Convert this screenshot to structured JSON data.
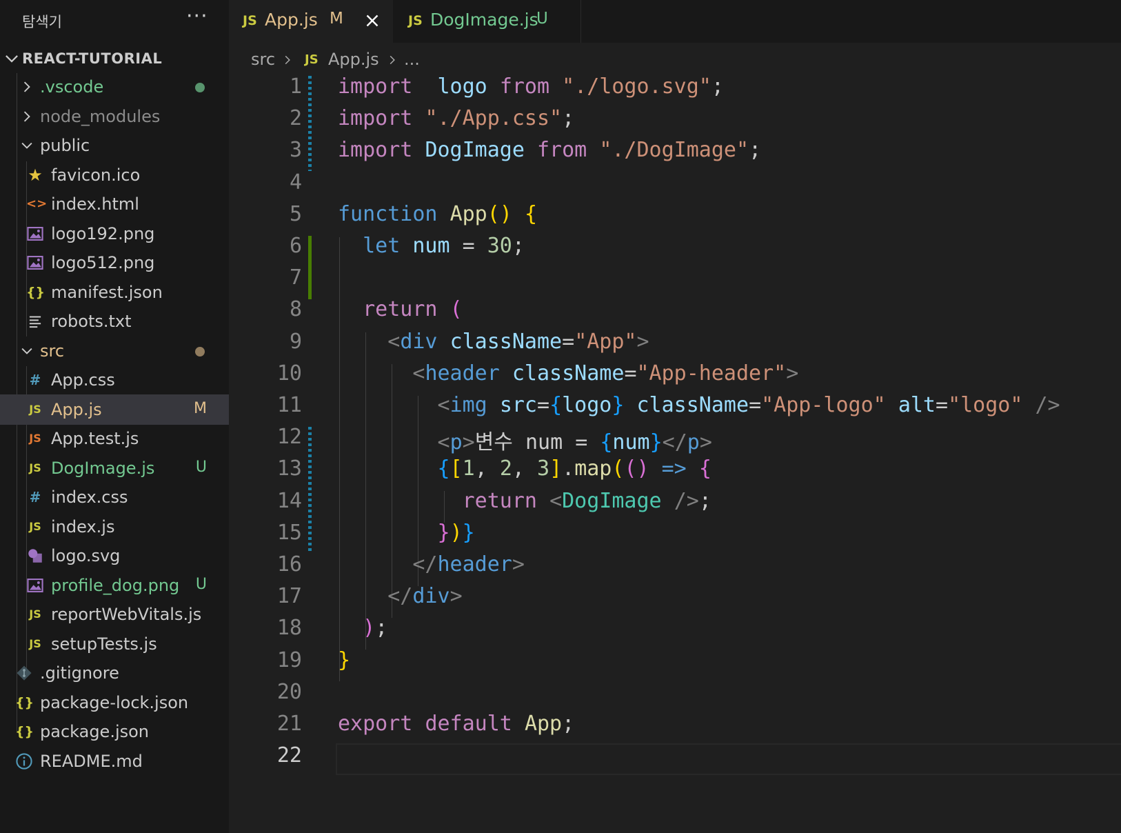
{
  "sidebar": {
    "title": "탐색기",
    "more": "···",
    "project": "REACT-TUTORIAL",
    "items": [
      {
        "label": ".vscode",
        "icon": "chevron-right-icon"
      },
      {
        "label": "node_modules",
        "icon": "chevron-right-icon"
      },
      {
        "label": "public",
        "icon": "chevron-down-icon"
      },
      {
        "label": "favicon.ico",
        "icon": "star-icon"
      },
      {
        "label": "index.html",
        "icon": "html-icon"
      },
      {
        "label": "logo192.png",
        "icon": "image-icon"
      },
      {
        "label": "logo512.png",
        "icon": "image-icon"
      },
      {
        "label": "manifest.json",
        "icon": "json-icon"
      },
      {
        "label": "robots.txt",
        "icon": "text-file-icon"
      },
      {
        "label": "src",
        "icon": "chevron-down-icon"
      },
      {
        "label": "App.css",
        "icon": "css-icon"
      },
      {
        "label": "App.js",
        "icon": "js-icon",
        "status": "M"
      },
      {
        "label": "App.test.js",
        "icon": "js-test-icon"
      },
      {
        "label": "DogImage.js",
        "icon": "js-icon",
        "status": "U"
      },
      {
        "label": "index.css",
        "icon": "css-icon"
      },
      {
        "label": "index.js",
        "icon": "js-icon"
      },
      {
        "label": "logo.svg",
        "icon": "svg-icon"
      },
      {
        "label": "profile_dog.png",
        "icon": "image-icon",
        "status": "U"
      },
      {
        "label": "reportWebVitals.js",
        "icon": "js-icon"
      },
      {
        "label": "setupTests.js",
        "icon": "js-icon"
      },
      {
        "label": ".gitignore",
        "icon": "git-icon"
      },
      {
        "label": "package-lock.json",
        "icon": "json-icon"
      },
      {
        "label": "package.json",
        "icon": "json-icon"
      },
      {
        "label": "README.md",
        "icon": "info-icon"
      }
    ]
  },
  "tabs": [
    {
      "label": "App.js",
      "icon": "JS",
      "status": "M",
      "active": true
    },
    {
      "label": "DogImage.js",
      "icon": "JS",
      "status": "U",
      "active": false
    }
  ],
  "breadcrumb": {
    "folder": "src",
    "icon": "JS",
    "file": "App.js",
    "more": "..."
  },
  "editor": {
    "line_numbers": [
      "1",
      "2",
      "3",
      "4",
      "5",
      "6",
      "7",
      "8",
      "9",
      "10",
      "11",
      "12",
      "13",
      "14",
      "15",
      "16",
      "17",
      "18",
      "19",
      "20",
      "21",
      "22"
    ],
    "current_line": 22,
    "lines": [
      [
        [
          "kw",
          "import"
        ],
        [
          "",
          "  "
        ],
        [
          "va",
          "logo"
        ],
        [
          "",
          " "
        ],
        [
          "kw",
          "from"
        ],
        [
          "",
          " "
        ],
        [
          "st",
          "\"./logo.svg\""
        ],
        [
          "",
          ";"
        ]
      ],
      [
        [
          "kw",
          "import"
        ],
        [
          "",
          " "
        ],
        [
          "st",
          "\"./App.css\""
        ],
        [
          "",
          ";"
        ]
      ],
      [
        [
          "kw",
          "import"
        ],
        [
          "",
          " "
        ],
        [
          "va",
          "DogImage"
        ],
        [
          "",
          " "
        ],
        [
          "kw",
          "from"
        ],
        [
          "",
          " "
        ],
        [
          "st",
          "\"./DogImage\""
        ],
        [
          "",
          ";"
        ]
      ],
      [],
      [
        [
          "kb",
          "function"
        ],
        [
          "",
          " "
        ],
        [
          "fn",
          "App"
        ],
        [
          "b1",
          "()"
        ],
        [
          "",
          " "
        ],
        [
          "b1",
          "{"
        ]
      ],
      [
        [
          "",
          "  "
        ],
        [
          "kb",
          "let"
        ],
        [
          "",
          " "
        ],
        [
          "va",
          "num"
        ],
        [
          "",
          " = "
        ],
        [
          "nu",
          "30"
        ],
        [
          "",
          ";"
        ]
      ],
      [],
      [
        [
          "",
          "  "
        ],
        [
          "kw",
          "return"
        ],
        [
          "",
          " "
        ],
        [
          "b2",
          "("
        ]
      ],
      [
        [
          "",
          "    "
        ],
        [
          "pu",
          "<"
        ],
        [
          "tg",
          "div"
        ],
        [
          "",
          " "
        ],
        [
          "va",
          "className"
        ],
        [
          "",
          "="
        ],
        [
          "st",
          "\"App\""
        ],
        [
          "pu",
          ">"
        ]
      ],
      [
        [
          "",
          "      "
        ],
        [
          "pu",
          "<"
        ],
        [
          "tg",
          "header"
        ],
        [
          "",
          " "
        ],
        [
          "va",
          "className"
        ],
        [
          "",
          "="
        ],
        [
          "st",
          "\"App-header\""
        ],
        [
          "pu",
          ">"
        ]
      ],
      [
        [
          "",
          "        "
        ],
        [
          "pu",
          "<"
        ],
        [
          "tg",
          "img"
        ],
        [
          "",
          " "
        ],
        [
          "va",
          "src"
        ],
        [
          "",
          "="
        ],
        [
          "b3",
          "{"
        ],
        [
          "va",
          "logo"
        ],
        [
          "b3",
          "}"
        ],
        [
          "",
          " "
        ],
        [
          "va",
          "className"
        ],
        [
          "",
          "="
        ],
        [
          "st",
          "\"App-logo\""
        ],
        [
          "",
          " "
        ],
        [
          "va",
          "alt"
        ],
        [
          "",
          "="
        ],
        [
          "st",
          "\"logo\""
        ],
        [
          "",
          " "
        ],
        [
          "pu",
          "/>"
        ]
      ],
      [
        [
          "",
          "        "
        ],
        [
          "pu",
          "<"
        ],
        [
          "tg",
          "p"
        ],
        [
          "pu",
          ">"
        ],
        [
          "",
          "변수 num = "
        ],
        [
          "b3",
          "{"
        ],
        [
          "va",
          "num"
        ],
        [
          "b3",
          "}"
        ],
        [
          "pu",
          "</"
        ],
        [
          "tg",
          "p"
        ],
        [
          "pu",
          ">"
        ]
      ],
      [
        [
          "",
          "        "
        ],
        [
          "b3",
          "{"
        ],
        [
          "b1",
          "["
        ],
        [
          "nu",
          "1"
        ],
        [
          "",
          ", "
        ],
        [
          "nu",
          "2"
        ],
        [
          "",
          ", "
        ],
        [
          "nu",
          "3"
        ],
        [
          "b1",
          "]"
        ],
        [
          "",
          "."
        ],
        [
          "fn",
          "map"
        ],
        [
          "b1",
          "("
        ],
        [
          "b2",
          "()"
        ],
        [
          "",
          " "
        ],
        [
          "kb",
          "=>"
        ],
        [
          "",
          " "
        ],
        [
          "b2",
          "{"
        ]
      ],
      [
        [
          "",
          "          "
        ],
        [
          "kw",
          "return"
        ],
        [
          "",
          " "
        ],
        [
          "pu",
          "<"
        ],
        [
          "cp",
          "DogImage"
        ],
        [
          "",
          " "
        ],
        [
          "pu",
          "/>"
        ],
        [
          "",
          ";"
        ]
      ],
      [
        [
          "",
          "        "
        ],
        [
          "b2",
          "}"
        ],
        [
          "b1",
          ")"
        ],
        [
          "b3",
          "}"
        ]
      ],
      [
        [
          "",
          "      "
        ],
        [
          "pu",
          "</"
        ],
        [
          "tg",
          "header"
        ],
        [
          "pu",
          ">"
        ]
      ],
      [
        [
          "",
          "    "
        ],
        [
          "pu",
          "</"
        ],
        [
          "tg",
          "div"
        ],
        [
          "pu",
          ">"
        ]
      ],
      [
        [
          "",
          "  "
        ],
        [
          "b2",
          ")"
        ],
        [
          "",
          ";"
        ]
      ],
      [
        [
          "b1",
          "}"
        ]
      ],
      [],
      [
        [
          "kw",
          "export"
        ],
        [
          "",
          " "
        ],
        [
          "kw",
          "default"
        ],
        [
          "",
          " "
        ],
        [
          "fn",
          "App"
        ],
        [
          "",
          ";"
        ]
      ],
      []
    ]
  },
  "colors": {
    "sidebar_bg": "#181818",
    "editor_bg": "#1f1f1f",
    "modified": "#e2c08d",
    "untracked": "#73c991",
    "js_icon": "#cbcb41"
  }
}
